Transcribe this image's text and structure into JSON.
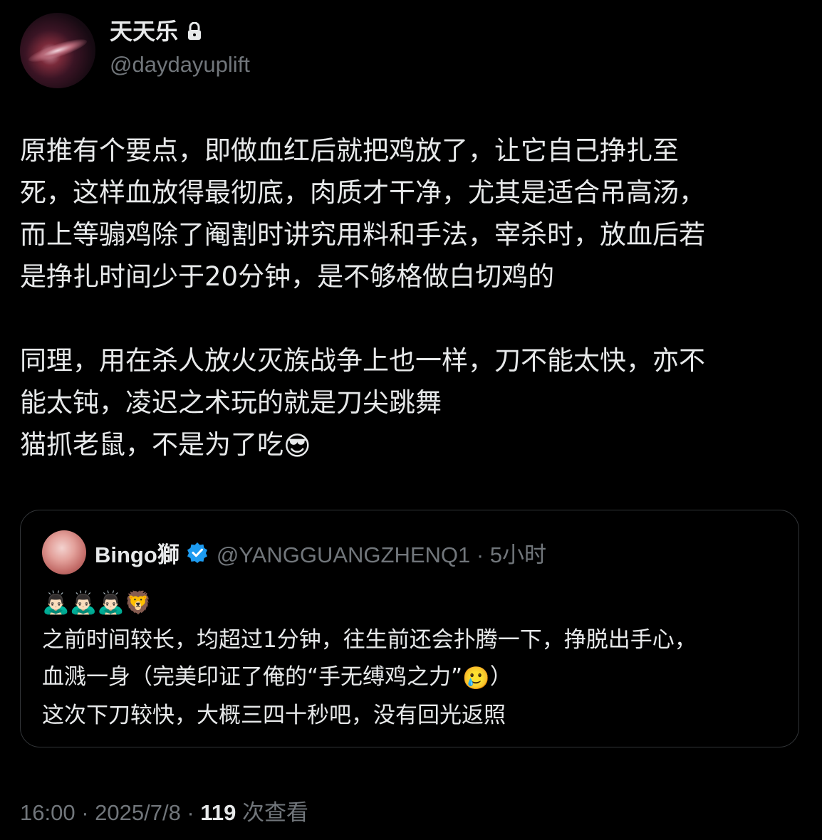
{
  "author": {
    "display_name": "天天乐",
    "handle": "@daydayuplift",
    "avatar_icon": "galaxy-avatar",
    "lock_icon": "lock-icon"
  },
  "tweet": {
    "paragraph1": "原推有个要点，即做血红后就把鸡放了，让它自己挣扎至\n死，这样血放得最彻底，肉质才干净，尤其是适合吊高汤，\n而上等骟鸡除了阉割时讲究用料和手法，宰杀时，放血后若\n是挣扎时间少于20分钟，是不够格做白切鸡的",
    "paragraph2": "同理，用在杀人放火灭族战争上也一样，刀不能太快，亦不\n能太钝，凌迟之术玩的就是刀尖跳舞",
    "paragraph3": "猫抓老鼠，不是为了吃",
    "paragraph3_emoji": "😎"
  },
  "quote": {
    "display_name": "Bingo獅",
    "handle_time": "@YANGGUANGZHENQ1 · 5小时",
    "emoji_line": "🙇🏻‍♂️🙇🏻‍♂️🙇🏻‍♂️🦁",
    "line1": "之前时间较长，均超过1分钟，往生前还会扑腾一下，挣脱出手心，",
    "line2a": "血溅一身（完美印证了俺的“手无缚鸡之力”",
    "line2_emoji": "🥲",
    "line2b": "）",
    "line3": "这次下刀较快，大概三四十秒吧，没有回光返照",
    "verified_color": "#1d9bf0"
  },
  "footer": {
    "time": "16:00",
    "date": "2025/7/8",
    "separator": " · ",
    "views_count": "119",
    "views_label": " 次查看"
  }
}
